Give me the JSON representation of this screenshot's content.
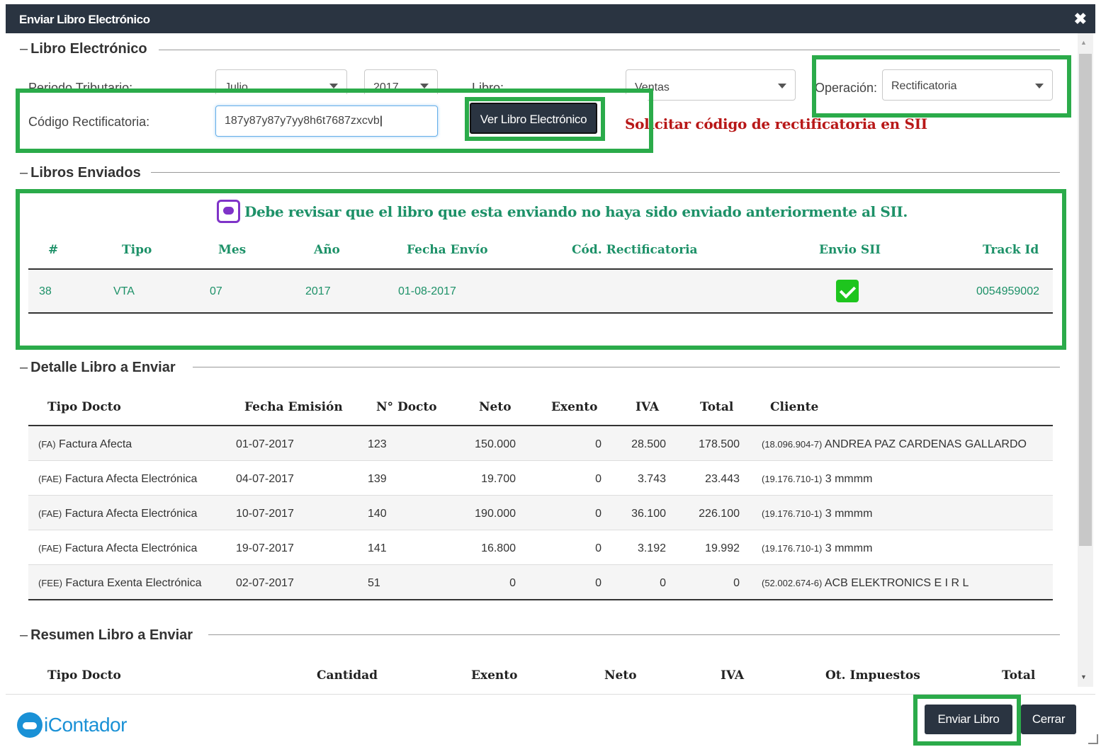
{
  "dialog": {
    "title": "Enviar Libro Electrónico",
    "close_glyph": "✖"
  },
  "libro_electronico": {
    "legend": "Libro Electrónico",
    "periodo_label": "Periodo Tributario:",
    "mes_value": "Julio",
    "anio_value": "2017",
    "libro_label": "Libro:",
    "libro_value": "Ventas",
    "operacion_label": "Operación:",
    "operacion_value": "Rectificatoria",
    "codigo_label": "Código Rectificatoria:",
    "codigo_value": "187y87y87y7yy8h6t7687zxcvb",
    "ver_button": "Ver Libro Electrónico",
    "solicitar_link": "Solicitar código de rectificatoria en SII"
  },
  "libros_enviados": {
    "legend": "Libros Enviados",
    "notice": "Debe revisar que el libro que esta enviando no haya sido enviado anteriormente al SII.",
    "columns": [
      "#",
      "Tipo",
      "Mes",
      "Año",
      "Fecha Envío",
      "Cód. Rectificatoria",
      "Envio SII",
      "Track Id"
    ],
    "rows": [
      {
        "num": "38",
        "tipo": "VTA",
        "mes": "07",
        "anio": "2017",
        "fecha": "01-08-2017",
        "cod": "",
        "envio": "check-icon",
        "track": "0054959002"
      }
    ]
  },
  "detalle": {
    "legend": "Detalle Libro a Enviar",
    "columns": [
      "Tipo Docto",
      "Fecha Emisión",
      "N° Docto",
      "Neto",
      "Exento",
      "IVA",
      "Total",
      "Cliente"
    ],
    "rows": [
      {
        "code": "(FA)",
        "tipo": "Factura Afecta",
        "fecha": "01-07-2017",
        "num": "123",
        "neto": "150.000",
        "exento": "0",
        "iva": "28.500",
        "total": "178.500",
        "rut": "(18.096.904-7)",
        "cliente": "ANDREA PAZ CARDENAS GALLARDO"
      },
      {
        "code": "(FAE)",
        "tipo": "Factura Afecta Electrónica",
        "fecha": "04-07-2017",
        "num": "139",
        "neto": "19.700",
        "exento": "0",
        "iva": "3.743",
        "total": "23.443",
        "rut": "(19.176.710-1)",
        "cliente": "3 mmmm"
      },
      {
        "code": "(FAE)",
        "tipo": "Factura Afecta Electrónica",
        "fecha": "10-07-2017",
        "num": "140",
        "neto": "190.000",
        "exento": "0",
        "iva": "36.100",
        "total": "226.100",
        "rut": "(19.176.710-1)",
        "cliente": "3 mmmm"
      },
      {
        "code": "(FAE)",
        "tipo": "Factura Afecta Electrónica",
        "fecha": "19-07-2017",
        "num": "141",
        "neto": "16.800",
        "exento": "0",
        "iva": "3.192",
        "total": "19.992",
        "rut": "(19.176.710-1)",
        "cliente": "3 mmmm"
      },
      {
        "code": "(FEE)",
        "tipo": "Factura Exenta Electrónica",
        "fecha": "02-07-2017",
        "num": "51",
        "neto": "0",
        "exento": "0",
        "iva": "0",
        "total": "0",
        "rut": "(52.002.674-6)",
        "cliente": "ACB ELEKTRONICS E I R L"
      }
    ]
  },
  "resumen": {
    "legend": "Resumen Libro a Enviar",
    "columns": [
      "Tipo Docto",
      "Cantidad",
      "Exento",
      "Neto",
      "IVA",
      "Ot. Impuestos",
      "Total"
    ]
  },
  "footer": {
    "logo_text": "iContador",
    "enviar_button": "Enviar Libro",
    "cerrar_button": "Cerrar"
  },
  "colors": {
    "header_bg": "#2a3441",
    "highlight": "#2bab4a",
    "teal": "#1d9168",
    "red": "#b81818",
    "check": "#1ec51e",
    "logo": "#1a91d6"
  }
}
